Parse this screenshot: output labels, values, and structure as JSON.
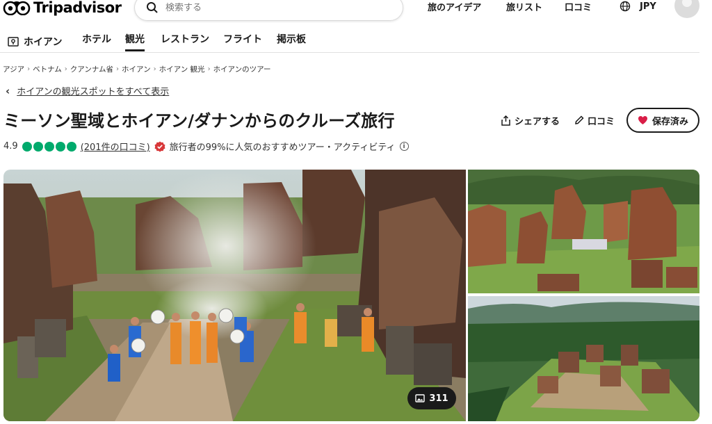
{
  "brand": {
    "name": "Tripadvisor"
  },
  "search": {
    "placeholder": "検索する"
  },
  "top_nav": [
    {
      "label": "旅のアイデア"
    },
    {
      "label": "旅リスト"
    },
    {
      "label": "口コミ"
    }
  ],
  "currency": "JPY",
  "sub_nav": {
    "home": "ホイアン",
    "items": [
      {
        "label": "ホテル"
      },
      {
        "label": "観光",
        "active": true
      },
      {
        "label": "レストラン"
      },
      {
        "label": "フライト"
      },
      {
        "label": "掲示板"
      }
    ]
  },
  "breadcrumb": [
    "アジア",
    "ベトナム",
    "クアンナム省",
    "ホイアン",
    "ホイアン 観光",
    "ホイアンのツアー"
  ],
  "back_link": "ホイアンの観光スポットをすべて表示",
  "title": "ミーソン聖域とホイアン/ダナンからのクルーズ旅行",
  "actions": {
    "share": "シェアする",
    "review": "口コミ",
    "save": "保存済み"
  },
  "rating": {
    "score": "4.9",
    "bubbles": 5,
    "reviews": "(201件の口コミ)",
    "badge_text": "旅行者の99%に人気のおすすめツアー・アクティビティ"
  },
  "gallery": {
    "photo_count": "311"
  },
  "colors": {
    "brand_green": "#00aa6c",
    "text": "#1a1a1a",
    "save_heart": "#d91e48",
    "badge_red": "#d8383a"
  }
}
